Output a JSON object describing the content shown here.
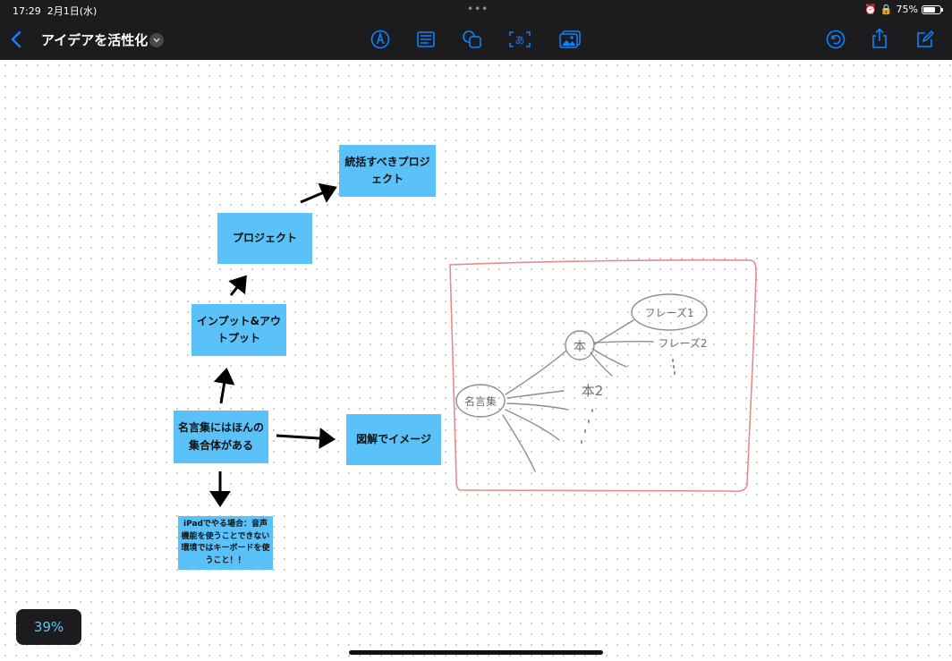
{
  "status_bar": {
    "time": "17:29",
    "date": "2月1日(水)",
    "battery_percent": "75%",
    "battery_level": 0.75
  },
  "toolbar": {
    "title": "アイデアを活性化",
    "icons": [
      "chevron-left-icon",
      "pen-icon",
      "note-icon",
      "shapes-icon",
      "text-box-icon",
      "media-icon",
      "undo-icon",
      "share-icon",
      "edit-icon"
    ]
  },
  "canvas": {
    "stickies": {
      "integrate": "統括すべきプロジェクト",
      "project": "プロジェクト",
      "input_output": "インプット&アウトプット",
      "quotes": "名言集にはほんの集合体がある",
      "diagram": "図解でイメージ",
      "ipad_note": "iPadでやる場合：音声機能を使うことできない環境ではキーボードを使うこと！！"
    },
    "sketch_labels": {
      "root": "名言集",
      "book": "本",
      "book2": "本2",
      "phrase1": "フレーズ1",
      "phrase2": "フレーズ2"
    }
  },
  "zoom_level": "39%",
  "colors": {
    "sticky": "#5ac2f8",
    "chrome": "#1c1c1e",
    "accent": "#0a84ff",
    "sketch_frame": "#e88a8a"
  }
}
